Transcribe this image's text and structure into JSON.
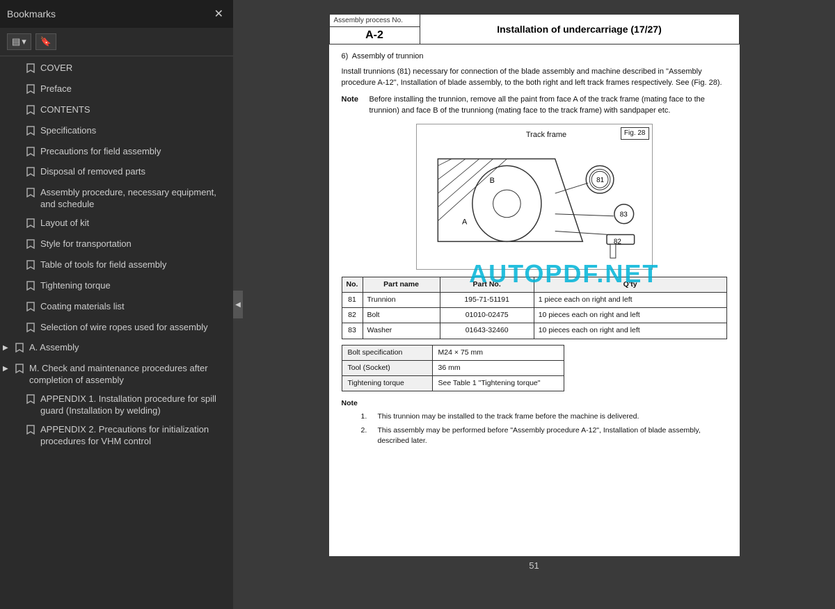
{
  "sidebar": {
    "title": "Bookmarks",
    "close_label": "✕",
    "toolbar": {
      "btn1_icon": "▤",
      "btn1_dropdown": "▾",
      "btn2_icon": "🔖"
    },
    "items": [
      {
        "id": "cover",
        "label": "COVER",
        "expandable": false,
        "indent": 0
      },
      {
        "id": "preface",
        "label": "Preface",
        "expandable": false,
        "indent": 0
      },
      {
        "id": "contents",
        "label": "CONTENTS",
        "expandable": false,
        "indent": 0
      },
      {
        "id": "specifications",
        "label": "Specifications",
        "expandable": false,
        "indent": 0
      },
      {
        "id": "precautions",
        "label": "Precautions for field assembly",
        "expandable": false,
        "indent": 0
      },
      {
        "id": "disposal",
        "label": "Disposal of removed parts",
        "expandable": false,
        "indent": 0
      },
      {
        "id": "assembly-proc",
        "label": "Assembly procedure, necessary equipment, and schedule",
        "expandable": false,
        "indent": 0
      },
      {
        "id": "layout",
        "label": "Layout of kit",
        "expandable": false,
        "indent": 0
      },
      {
        "id": "style-transport",
        "label": "Style for transportation",
        "expandable": false,
        "indent": 0
      },
      {
        "id": "table-tools",
        "label": "Table of tools for field assembly",
        "expandable": false,
        "indent": 0
      },
      {
        "id": "tightening",
        "label": "Tightening torque",
        "expandable": false,
        "indent": 0
      },
      {
        "id": "coating",
        "label": "Coating materials list",
        "expandable": false,
        "indent": 0
      },
      {
        "id": "wire-ropes",
        "label": "Selection of wire ropes used for assembly",
        "expandable": false,
        "indent": 0
      },
      {
        "id": "a-assembly",
        "label": "A. Assembly",
        "expandable": true,
        "expanded": false,
        "indent": 0
      },
      {
        "id": "m-check",
        "label": "M. Check and maintenance procedures after completion of assembly",
        "expandable": true,
        "expanded": false,
        "indent": 0
      },
      {
        "id": "appendix1",
        "label": "APPENDIX 1. Installation procedure for spill guard (Installation by welding)",
        "expandable": false,
        "indent": 0
      },
      {
        "id": "appendix2",
        "label": "APPENDIX 2. Precautions for initialization procedures for VHM control",
        "expandable": false,
        "indent": 0
      }
    ]
  },
  "doc": {
    "header": {
      "label": "Assembly process No.",
      "number": "A-2",
      "title": "Installation of undercarriage (17/27)"
    },
    "section_num": "6)",
    "section_title": "Assembly of trunnion",
    "para1": "Install trunnions (81) necessary for connection of the blade assembly and machine described in \"Assembly procedure A-12\", Installation of blade assembly, to the both right and left track frames respectively. See (Fig. 28).",
    "note_label": "Note",
    "note_text": "Before installing the trunnion, remove all the paint from face A of the track frame (mating face to the trunnion) and face B of the trunniong (mating face to the track frame) with sandpaper etc.",
    "diagram": {
      "fig_label": "Fig. 28",
      "track_frame_label": "Track frame"
    },
    "parts_table": {
      "headers": [
        "No.",
        "Part name",
        "Part No.",
        "Q'ty"
      ],
      "rows": [
        {
          "no": "81",
          "name": "Trunnion",
          "part_no": "195-71-51191",
          "qty": "1 piece each on right and left"
        },
        {
          "no": "82",
          "name": "Bolt",
          "part_no": "01010-02475",
          "qty": "10 pieces each on right and left"
        },
        {
          "no": "83",
          "name": "Washer",
          "part_no": "01643-32460",
          "qty": "10 pieces each on right and left"
        }
      ]
    },
    "spec_table": {
      "rows": [
        {
          "label": "Bolt specification",
          "value": "M24 × 75 mm"
        },
        {
          "label": "Tool (Socket)",
          "value": "36 mm"
        },
        {
          "label": "Tightening torque",
          "value": "See Table 1 \"Tightening torque\""
        }
      ]
    },
    "notes": [
      {
        "num": "1.",
        "text": "This trunnion may be installed to the track frame before the machine is delivered."
      },
      {
        "num": "2.",
        "text": "This assembly may be performed before \"Assembly procedure A-12\", Installation of blade assembly, described later."
      }
    ],
    "page_number": "51"
  },
  "watermark": "AUTOPDF.NET",
  "collapse_arrow": "◀"
}
